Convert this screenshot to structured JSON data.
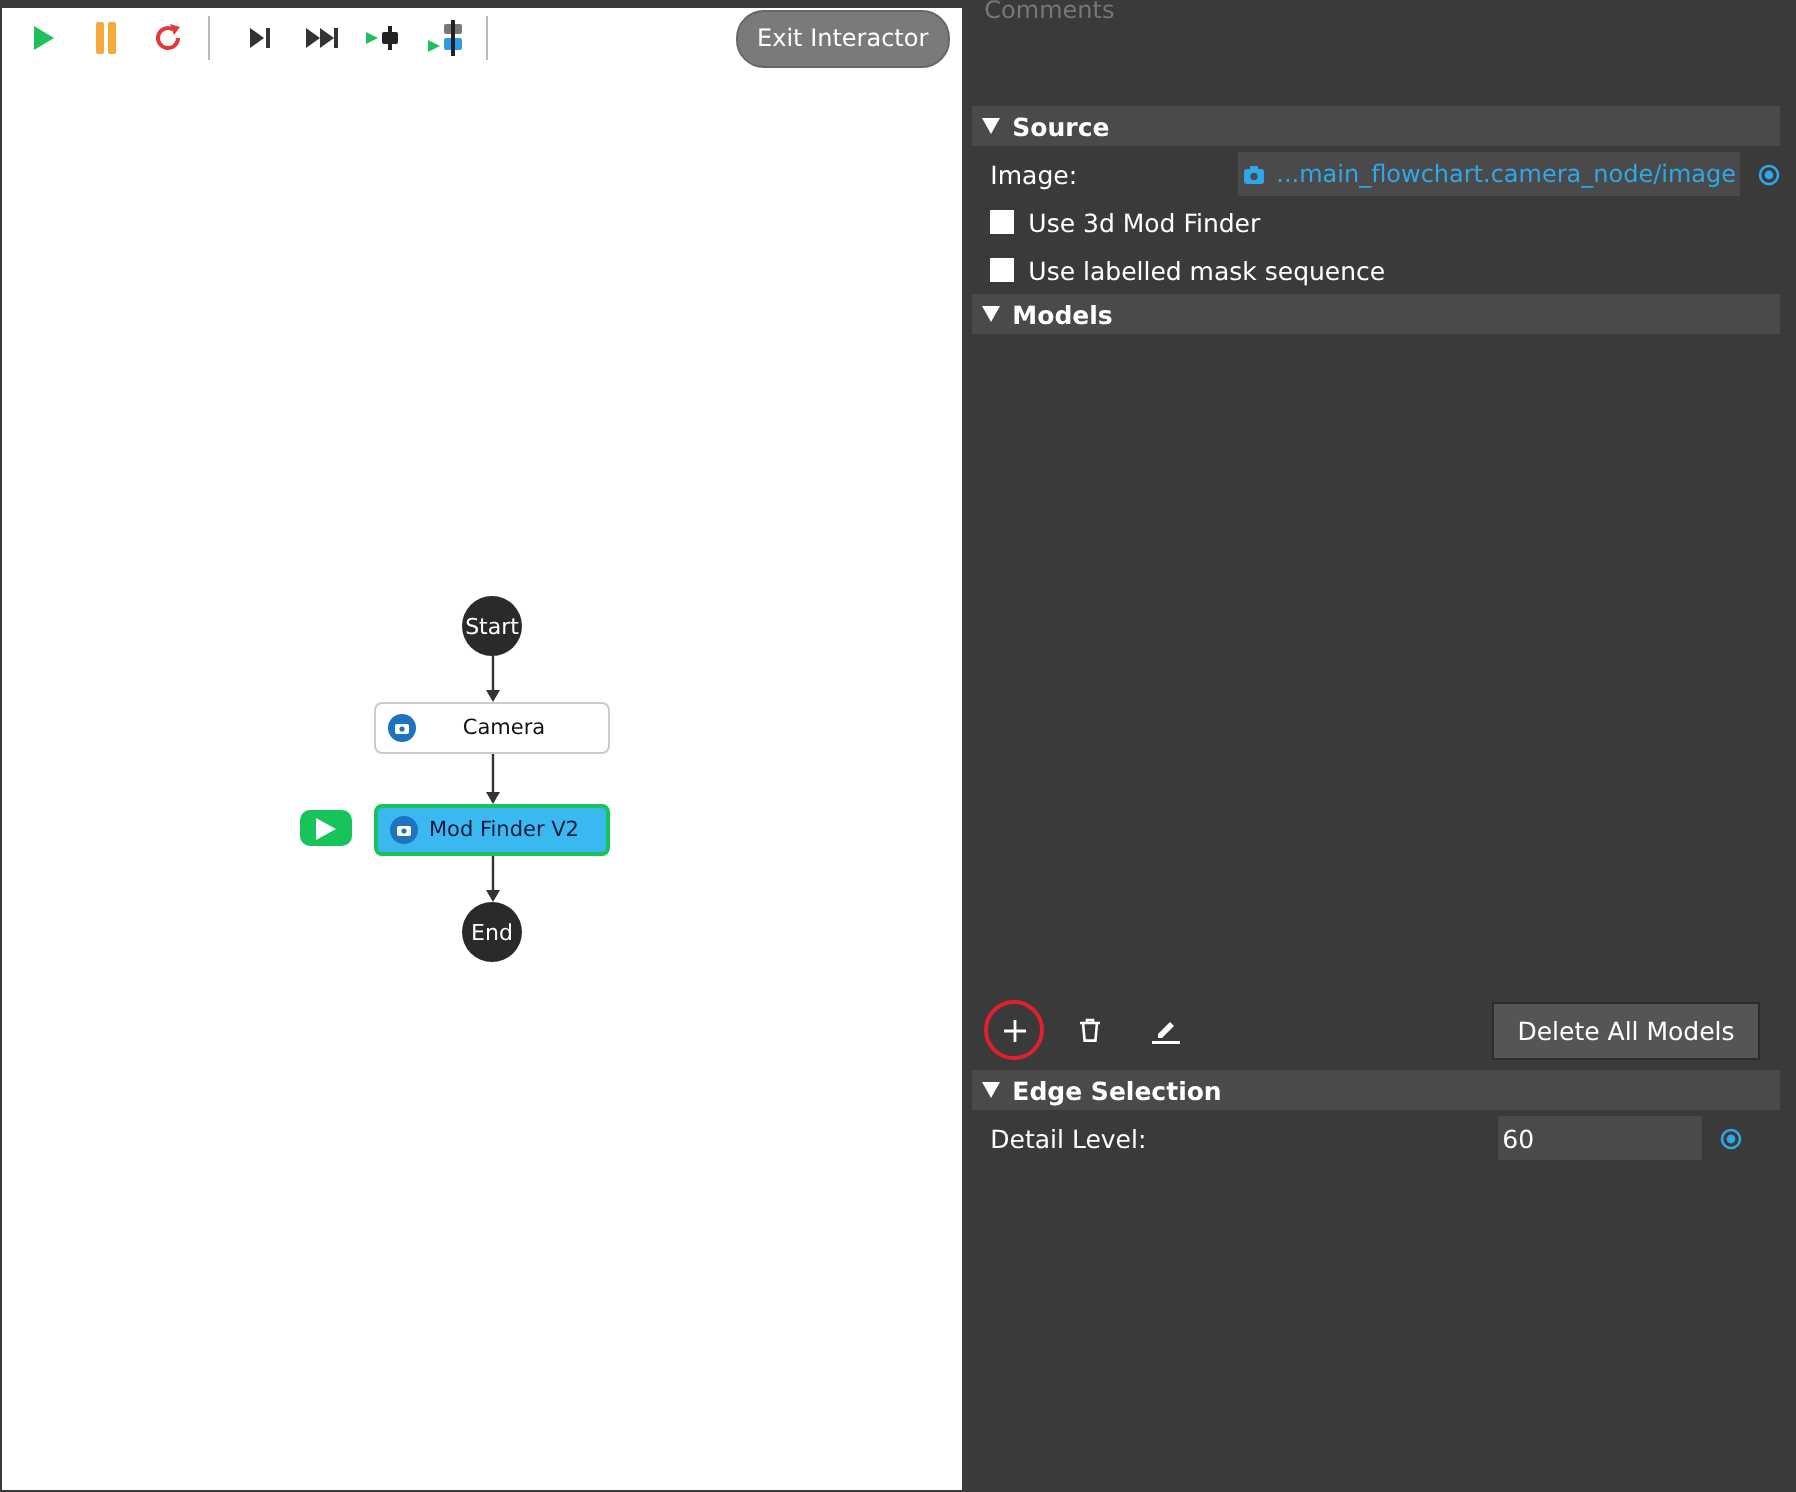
{
  "toolbar": {
    "groups": [
      [
        {
          "kind": "play"
        },
        {
          "kind": "pause"
        },
        {
          "kind": "restart"
        }
      ],
      [
        {
          "kind": "step"
        },
        {
          "kind": "run-to-end"
        },
        {
          "kind": "step-over"
        },
        {
          "kind": "step-into"
        }
      ]
    ],
    "exit_button": "Exit Interactor"
  },
  "flowchart": {
    "nodes": [
      {
        "kind": "terminal",
        "label": "Start"
      },
      {
        "kind": "process",
        "label": "Camera",
        "selected": false,
        "running": false
      },
      {
        "kind": "process",
        "label": "Mod Finder V2",
        "selected": true,
        "running": true
      },
      {
        "kind": "terminal",
        "label": "End"
      }
    ]
  },
  "properties": {
    "comments_label": "Comments",
    "sections": [
      {
        "title": "Source",
        "expanded": true,
        "rows": [
          {
            "kind": "link",
            "label": "Image:",
            "value": "...main_flowchart.camera_node/image"
          },
          {
            "kind": "checkbox",
            "label": "Use 3d Mod Finder",
            "checked": false
          },
          {
            "kind": "checkbox",
            "label": "Use labelled mask sequence",
            "checked": false
          }
        ]
      },
      {
        "title": "Models",
        "expanded": true,
        "rows": [
          {
            "kind": "model-list",
            "tools": [
              {
                "kind": "add",
                "circled": true
              },
              {
                "kind": "delete",
                "circled": false
              },
              {
                "kind": "edit",
                "circled": false
              }
            ],
            "button": "Delete All Models"
          }
        ]
      },
      {
        "title": "Edge Selection",
        "expanded": true,
        "rows": [
          {
            "kind": "number",
            "label": "Detail Level:",
            "value": "60"
          }
        ]
      }
    ]
  }
}
